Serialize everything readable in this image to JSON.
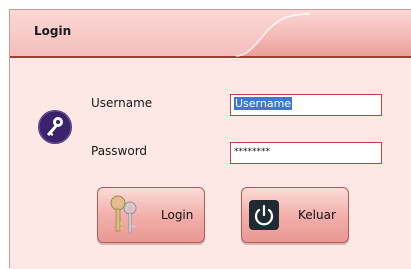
{
  "window": {
    "title": "Login"
  },
  "form": {
    "username_label": "Username",
    "username_value": "Username",
    "password_label": "Password",
    "password_value": "********"
  },
  "buttons": {
    "login_label": "Login",
    "exit_label": "Keluar"
  },
  "icons": {
    "login_dialog": "key-icon",
    "login_button": "keys-icon",
    "exit_button": "power-icon"
  },
  "colors": {
    "background": "#fde8e6",
    "title_gradient_bottom": "#ea9f9b",
    "border_accent": "#a93a36",
    "key_icon_circle": "#3a236b",
    "power_icon_bg": "#1f2a33",
    "selection": "#3c78d8"
  }
}
